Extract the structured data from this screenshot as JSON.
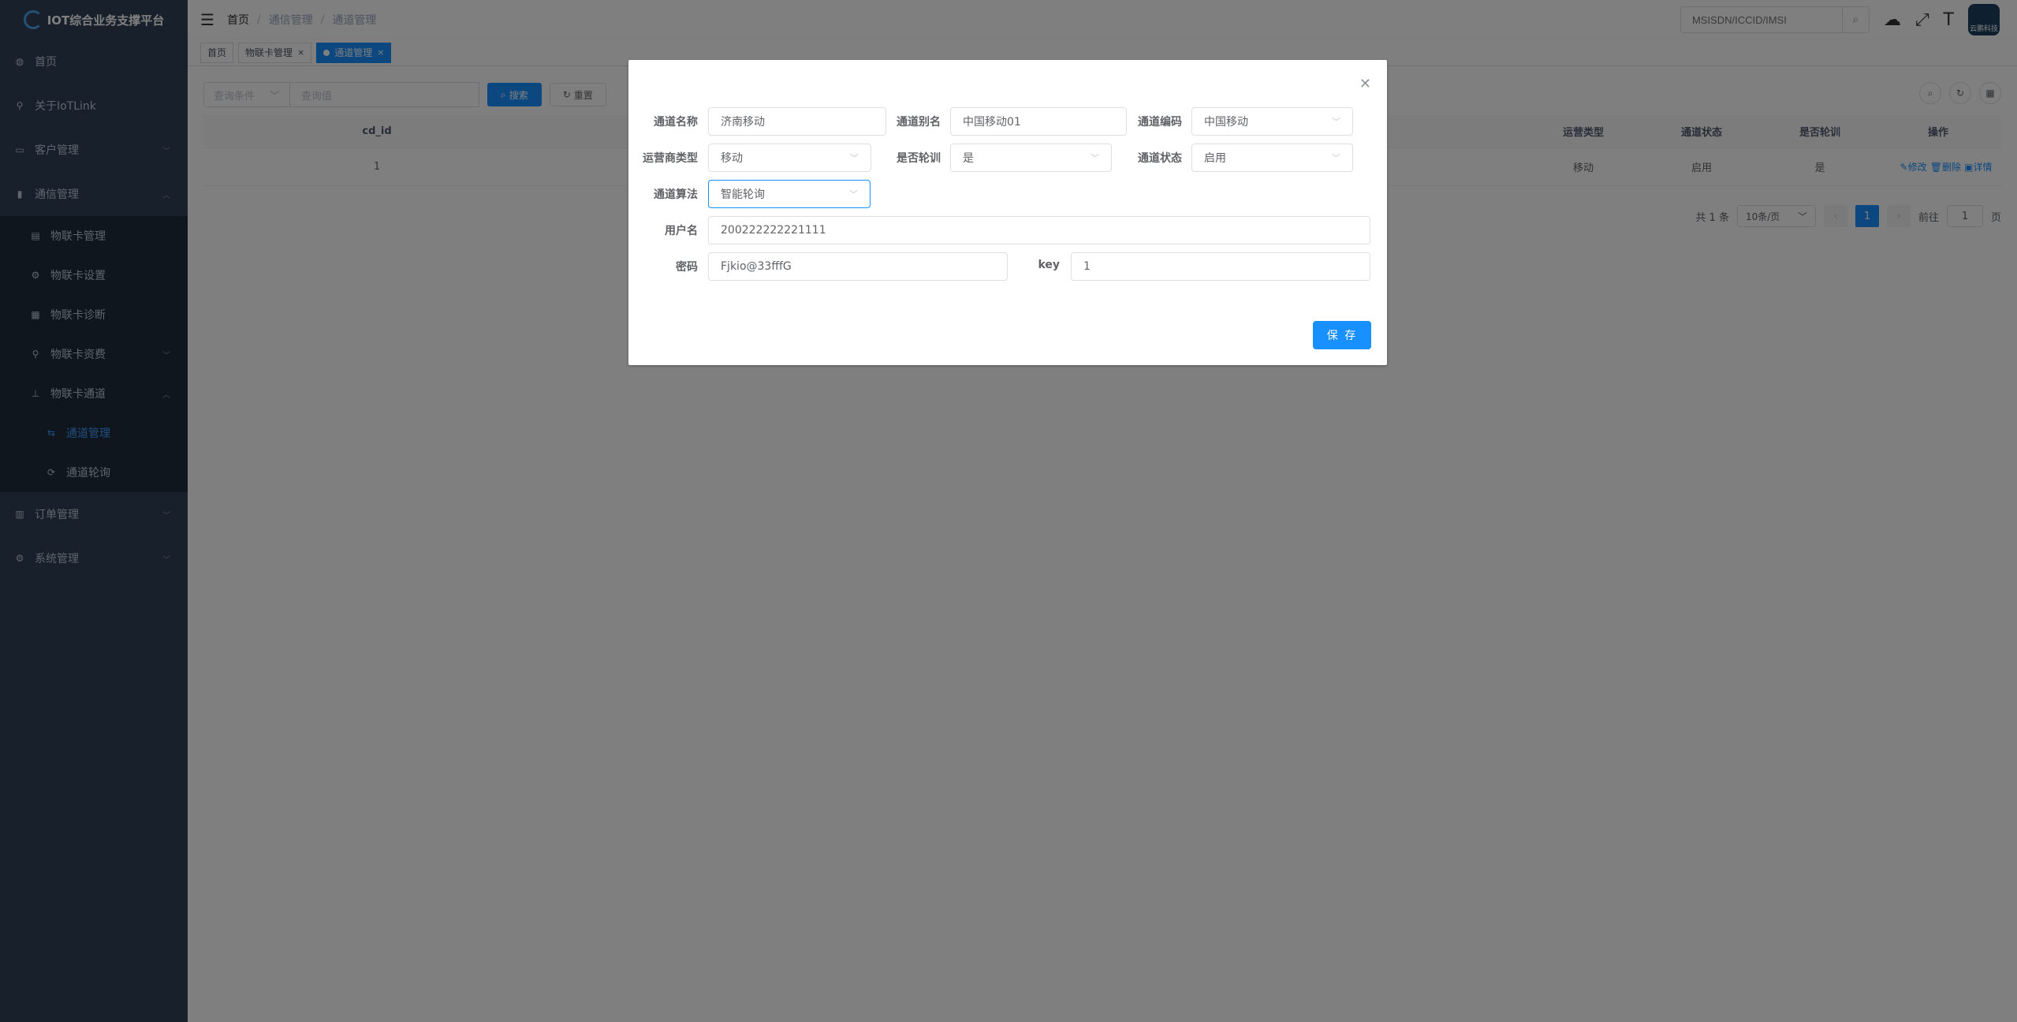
{
  "app": {
    "title": "IOT综合业务支撑平台"
  },
  "sidebar": {
    "items": [
      {
        "label": "首页",
        "icon": "dashboard-icon"
      },
      {
        "label": "关于IoTLink",
        "icon": "guide-icon"
      },
      {
        "label": "客户管理",
        "icon": "monitor-icon"
      },
      {
        "label": "通信管理",
        "icon": "book-icon"
      }
    ],
    "comm_children": [
      {
        "label": "物联卡管理"
      },
      {
        "label": "物联卡设置"
      },
      {
        "label": "物联卡诊断"
      },
      {
        "label": "物联卡资费"
      },
      {
        "label": "物联卡通道"
      }
    ],
    "channel_children": [
      {
        "label": "通道管理"
      },
      {
        "label": "通道轮询"
      }
    ],
    "bottom_items": [
      {
        "label": "订单管理"
      },
      {
        "label": "系统管理"
      }
    ]
  },
  "header": {
    "breadcrumb": [
      "首页",
      "通信管理",
      "通道管理"
    ],
    "search_placeholder": "MSISDN/ICCID/IMSI",
    "avatar_text": "云鹏科技"
  },
  "tags": [
    {
      "label": "首页"
    },
    {
      "label": "物联卡管理",
      "close": "×"
    },
    {
      "label": "通道管理",
      "close": "×"
    }
  ],
  "query": {
    "condition_placeholder": "查询条件",
    "value_placeholder": "查询值",
    "search_label": "搜索",
    "reset_label": "重置"
  },
  "table": {
    "headers": {
      "cd_id": "cd_id",
      "op_type": "运营类型",
      "status": "通道状态",
      "poll": "是否轮训",
      "actions": "操作"
    },
    "rows": [
      {
        "cd_id": "1",
        "op_type": "移动",
        "status": "启用",
        "poll": "是",
        "edit": "修改",
        "delete": "删除",
        "detail": "详情"
      }
    ]
  },
  "pagination": {
    "total": "共 1 条",
    "page_size": "10条/页",
    "current": "1",
    "goto_label": "前往",
    "goto_value": "1",
    "page_unit": "页"
  },
  "dialog": {
    "channel_name_label": "通道名称",
    "channel_name": "济南移动",
    "channel_alias_label": "通道别名",
    "channel_alias": "中国移动01",
    "channel_code_label": "通道编码",
    "channel_code": "中国移动",
    "operator_type_label": "运营商类型",
    "operator_type": "移动",
    "polling_label": "是否轮训",
    "polling": "是",
    "channel_status_label": "通道状态",
    "channel_status": "启用",
    "algorithm_label": "通道算法",
    "algorithm": "智能轮询",
    "username_label": "用户名",
    "username": "200222222221111",
    "password_label": "密码",
    "password": "Fjkio@33fffG",
    "key_label": "key",
    "key": "1",
    "save_label": "保 存"
  },
  "colors": {
    "primary": "#1890ff",
    "sidebar_bg": "#304156",
    "submenu_bg": "#1f2d3d",
    "overlay": "rgba(0,0,0,0.5)"
  }
}
